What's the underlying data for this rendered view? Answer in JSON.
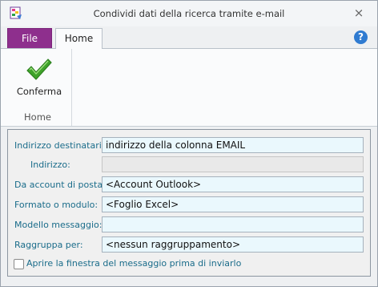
{
  "window": {
    "title": "Condividi dati della ricerca tramite e-mail"
  },
  "icons": {
    "app": "app-icon",
    "close": "close-icon",
    "help": "help-icon",
    "confirm": "checkmark-icon"
  },
  "close_glyph": "⨯",
  "help_glyph": "?",
  "ribbon": {
    "tabs": [
      {
        "label": "File"
      },
      {
        "label": "Home"
      }
    ],
    "groups": [
      {
        "label": "Home",
        "buttons": [
          {
            "label": "Conferma"
          }
        ]
      }
    ]
  },
  "colors": {
    "file_tab": "#8e2f8d",
    "label": "#1a6c8a",
    "checkmark": "#3fa32b",
    "field_bg": "#eaf8fd"
  },
  "form": {
    "fields": [
      {
        "label": "Indirizzo destinatario:",
        "value": "indirizzo della colonna EMAIL"
      },
      {
        "label": "Indirizzo:",
        "value": ""
      },
      {
        "label": "Da account di posta:",
        "value": "<Account Outlook>"
      },
      {
        "label": "Formato o modulo:",
        "value": "<Foglio Excel>"
      },
      {
        "label": "Modello messaggio:",
        "value": ""
      },
      {
        "label": "Raggruppa per:",
        "value": "<nessun raggruppamento>"
      }
    ],
    "checkbox": {
      "label": "Aprire la finestra del messaggio prima di inviarlo",
      "checked": false
    }
  }
}
